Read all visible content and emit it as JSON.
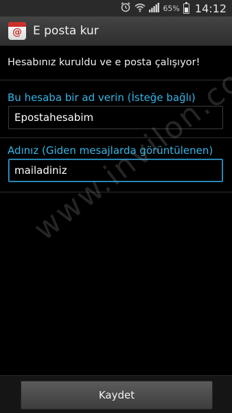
{
  "status_bar": {
    "battery": "65%",
    "time": "14:12",
    "icons": [
      "alarm-icon",
      "wifi-icon",
      "signal-icon",
      "battery-icon"
    ],
    "battery_level": 0.65
  },
  "title_bar": {
    "app_icon": "email-at-icon",
    "app_icon_glyph": "@",
    "title": "E posta kur"
  },
  "content": {
    "intro": "Hesabınız kuruldu ve e posta çalışıyor!",
    "account_name_label": "Bu hesaba bir ad verin (İsteğe bağlı)",
    "account_name_value": "Epostahesabim",
    "your_name_label": "Adınız (Giden mesajlarda görüntülenen)",
    "your_name_value": "mailadiniz"
  },
  "watermark": "www.invilon.com",
  "footer": {
    "save_label": "Kaydet"
  },
  "colors": {
    "accent": "#34b6e6",
    "app_icon_red": "#c9302c"
  }
}
